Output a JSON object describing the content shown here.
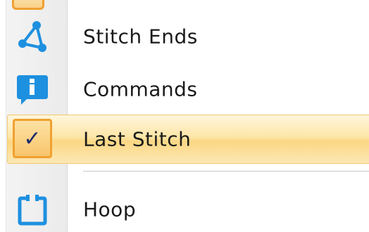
{
  "menu": {
    "items": [
      {
        "label": "Stitch Ends",
        "icon": "stitch-ends-icon"
      },
      {
        "label": "Commands",
        "icon": "info-icon"
      },
      {
        "label": "Last Stitch",
        "icon": "checkmark-icon",
        "checked": true,
        "highlighted": true
      },
      {
        "label": "Hoop",
        "icon": "hoop-icon"
      }
    ],
    "check_glyph": "✓"
  },
  "colors": {
    "icon_blue": "#1e90e0",
    "highlight_border": "#f0a030",
    "highlight_fill": "#fbd784",
    "text": "#1a1a1a"
  }
}
